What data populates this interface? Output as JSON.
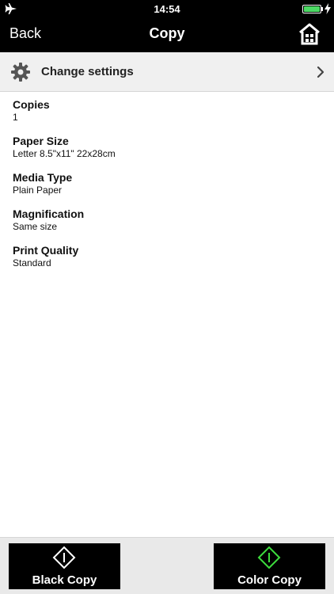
{
  "status_bar": {
    "time": "14:54",
    "battery_level": 1.0,
    "battery_color": "#4cd964",
    "icons": [
      "airplane-icon",
      "battery-icon",
      "charging-icon"
    ]
  },
  "nav": {
    "back_label": "Back",
    "title": "Copy",
    "home_icon": "home-icon"
  },
  "settings_row": {
    "label": "Change settings",
    "icon": "gear-icon",
    "chevron_icon": "chevron-right-icon"
  },
  "settings": [
    {
      "name": "Copies",
      "value": "1"
    },
    {
      "name": "Paper Size",
      "value": "Letter 8.5\"x11\" 22x28cm"
    },
    {
      "name": "Media Type",
      "value": "Plain Paper"
    },
    {
      "name": "Magnification",
      "value": "Same size"
    },
    {
      "name": "Print Quality",
      "value": "Standard"
    }
  ],
  "buttons": {
    "black_copy": {
      "label": "Black Copy",
      "icon_color": "#ffffff"
    },
    "color_copy": {
      "label": "Color Copy",
      "icon_color": "#3ddc3d"
    }
  }
}
